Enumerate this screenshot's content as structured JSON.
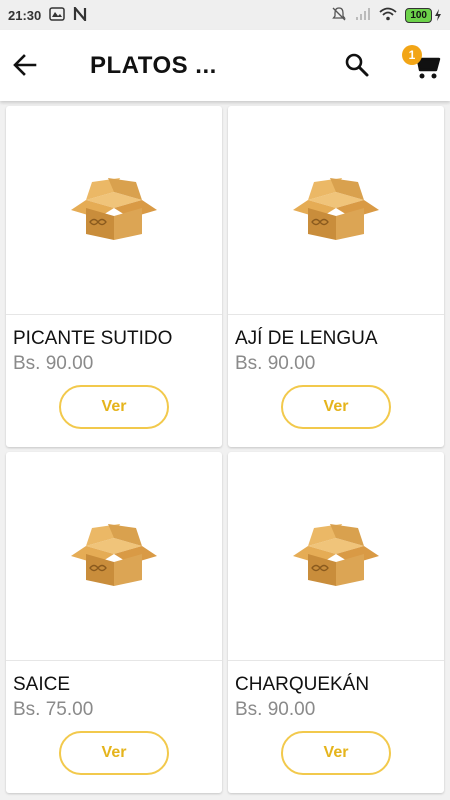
{
  "status_bar": {
    "time": "21:30",
    "battery": "100"
  },
  "header": {
    "title": "PLATOS ...",
    "cart_count": "1"
  },
  "products": [
    {
      "name": "PICANTE SUTIDO",
      "price": "Bs. 90.00",
      "button": "Ver"
    },
    {
      "name": "AJÍ DE LENGUA",
      "price": "Bs. 90.00",
      "button": "Ver"
    },
    {
      "name": "SAICE",
      "price": "Bs. 75.00",
      "button": "Ver"
    },
    {
      "name": "CHARQUEKÁN",
      "price": "Bs. 90.00",
      "button": "Ver"
    }
  ],
  "colors": {
    "accent": "#f2c94c",
    "badge": "#f2a516"
  }
}
